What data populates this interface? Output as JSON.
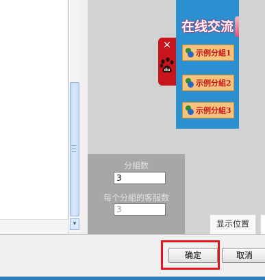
{
  "widget": {
    "title": "在线交流",
    "groups": [
      {
        "label": "示例分組1"
      },
      {
        "label": "示例分組2"
      },
      {
        "label": "示例分組3"
      }
    ]
  },
  "baidu_tab": {
    "close_symbol": "×",
    "logo_text": "du"
  },
  "settings": {
    "group_count_label": "分組数",
    "group_count_value": "3",
    "agents_per_group_label": "每个分組的客服数",
    "agents_per_group_value": "3"
  },
  "tabs": {
    "position_label": "显示位置"
  },
  "scrollbar": {
    "down_arrow": "▾"
  },
  "buttons": {
    "ok_label": "确定",
    "cancel_label": "取消"
  },
  "colors": {
    "widget_bg": "#2a90cf",
    "group_button_bg": "#f7c27a",
    "group_label_text": "#c3161c",
    "baidu_red": "#c8141b",
    "highlight_border": "#e4141e"
  },
  "icons": {
    "group_icon": "users-icon",
    "baidu_logo": "baidu-paw-icon"
  }
}
